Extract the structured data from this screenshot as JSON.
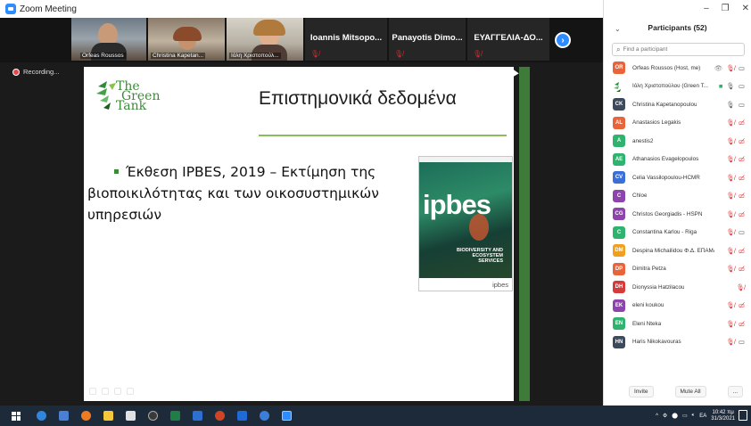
{
  "window": {
    "title": "Zoom Meeting"
  },
  "gallery": {
    "video_tiles": [
      {
        "name": "Orfeas Roussos"
      },
      {
        "name": "Christina Kapetan..."
      },
      {
        "name": "Ιόλη Χριστοπούλ..."
      }
    ],
    "name_tiles": [
      {
        "name": "Ioannis Mitsopo..."
      },
      {
        "name": "Panayotis Dimo..."
      },
      {
        "name": "ΕΥΑΓΓΕΛΙΑ-ΔΟ..."
      }
    ],
    "next_label": "›"
  },
  "recording_label": "Recording...",
  "slide": {
    "logo_text": [
      "The",
      "Green",
      "Tank"
    ],
    "title": "Επιστημονικά δεδομένα",
    "bullet": "Έκθεση IPBES, 2019 – Εκτίμηση της βιοποικιλότητας και των οικοσυστημικών υπηρεσιών",
    "book": {
      "title": "ipbes",
      "subtitle": "BIODIVERSITY AND ECOSYSTEM SERVICES",
      "footer_logo": "ipbes"
    }
  },
  "participants": {
    "title": "Participants (52)",
    "search_placeholder": "Find a participant",
    "list": [
      {
        "initials": "OR",
        "name": "Orfeas Roussos (Host, me)",
        "color": "#e8643a",
        "mic": "muted",
        "cam": "on",
        "extra": "👁"
      },
      {
        "initials": "",
        "name": "Ιόλη Χριστοπούλου (Green T...",
        "color": "#6ab04c",
        "mic": "on",
        "cam": "on",
        "extra": "",
        "logo": true
      },
      {
        "initials": "CK",
        "name": "Christina Kapetanopoulou",
        "color": "#3d4a5c",
        "mic": "on",
        "cam": "on",
        "extra": ""
      },
      {
        "initials": "AL",
        "name": "Anastasios Legakis",
        "color": "#e8643a",
        "mic": "muted",
        "cam": "off",
        "extra": ""
      },
      {
        "initials": "A",
        "name": "anestis2",
        "color": "#2fb36f",
        "mic": "muted",
        "cam": "off",
        "extra": ""
      },
      {
        "initials": "AE",
        "name": "Athanasios Evagelopoulos",
        "color": "#2fb36f",
        "mic": "muted",
        "cam": "off",
        "extra": ""
      },
      {
        "initials": "CV",
        "name": "Celia Vassilopoulou-HCMR",
        "color": "#3b6fd8",
        "mic": "muted",
        "cam": "off",
        "extra": ""
      },
      {
        "initials": "C",
        "name": "Chloe",
        "color": "#8e44ad",
        "mic": "muted",
        "cam": "off",
        "extra": ""
      },
      {
        "initials": "CG",
        "name": "Christos Georgiadis - HSPN",
        "color": "#8e44ad",
        "mic": "muted",
        "cam": "off",
        "extra": ""
      },
      {
        "initials": "C",
        "name": "Constantina Karlou - Riga",
        "color": "#2fb36f",
        "mic": "muted",
        "cam": "on",
        "extra": ""
      },
      {
        "initials": "DM",
        "name": "Despina Michailidou Φ.Δ. ΕΠΑΜΑΘ",
        "color": "#f0a020",
        "mic": "muted",
        "cam": "off",
        "extra": ""
      },
      {
        "initials": "DP",
        "name": "Dimitra Petza",
        "color": "#e8643a",
        "mic": "muted",
        "cam": "off",
        "extra": ""
      },
      {
        "initials": "DH",
        "name": "Dionyssia Hatzilacou",
        "color": "#d63a3a",
        "mic": "muted",
        "cam": "none",
        "extra": ""
      },
      {
        "initials": "EK",
        "name": "eleni koukou",
        "color": "#8e44ad",
        "mic": "muted",
        "cam": "off",
        "extra": ""
      },
      {
        "initials": "EN",
        "name": "Eleni Nteka",
        "color": "#2fb36f",
        "mic": "muted",
        "cam": "off",
        "extra": ""
      },
      {
        "initials": "HN",
        "name": "Haris Nikokavouras",
        "color": "#3d4a5c",
        "mic": "muted",
        "cam": "on",
        "extra": ""
      }
    ],
    "invite_label": "Invite",
    "mute_all_label": "Mute All",
    "more_label": "..."
  },
  "taskbar": {
    "lang": "EA",
    "time": "10:42 πμ",
    "date": "31/3/2021"
  }
}
